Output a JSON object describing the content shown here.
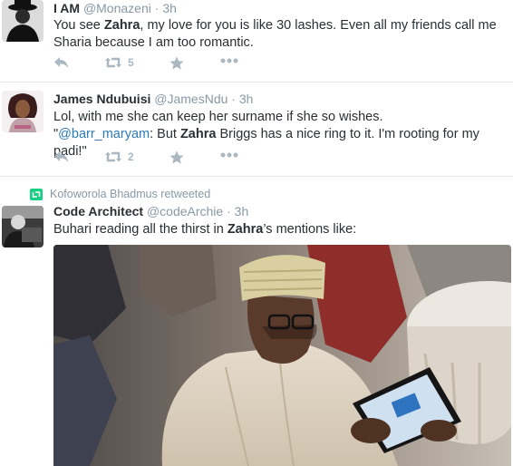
{
  "tweets": [
    {
      "name": "I AM",
      "handle": "@Monazeni",
      "separator": "·",
      "time": "3h",
      "text_parts": [
        "You see ",
        "Zahra",
        ", my love for you is like 30 lashes. Even all my friends call me Sharia because I am too romantic."
      ],
      "retweets": "5"
    },
    {
      "name": "James Ndubuisi",
      "handle": "@JamesNdu",
      "separator": "·",
      "time": "3h",
      "line1": "Lol, with me she can keep her surname if she so wishes.",
      "quote_open": "\"",
      "mention": "@barr_maryam",
      "line2_a": ": But ",
      "line2_bold": "Zahra",
      "line2_b": " Briggs has a nice ring to it. I'm rooting for my padi!\"",
      "retweets": "2"
    },
    {
      "retweeted_by": "Kofoworola Bhadmus retweeted",
      "name": "Code Architect",
      "handle": "@codeArchie",
      "separator": "·",
      "time": "3h",
      "text_a": "Buhari reading all the thirst in ",
      "text_bold": "Zahra",
      "text_b": "’s mentions like:"
    }
  ],
  "icons": {
    "reply": "reply-icon",
    "retweet": "retweet-icon",
    "favorite": "star-icon",
    "more": "more-dots-icon"
  },
  "colors": {
    "text": "#292f33",
    "muted": "#8899a6",
    "link": "#2b7bb9",
    "action": "#aab8c2",
    "retweet_green": "#19cf86"
  }
}
